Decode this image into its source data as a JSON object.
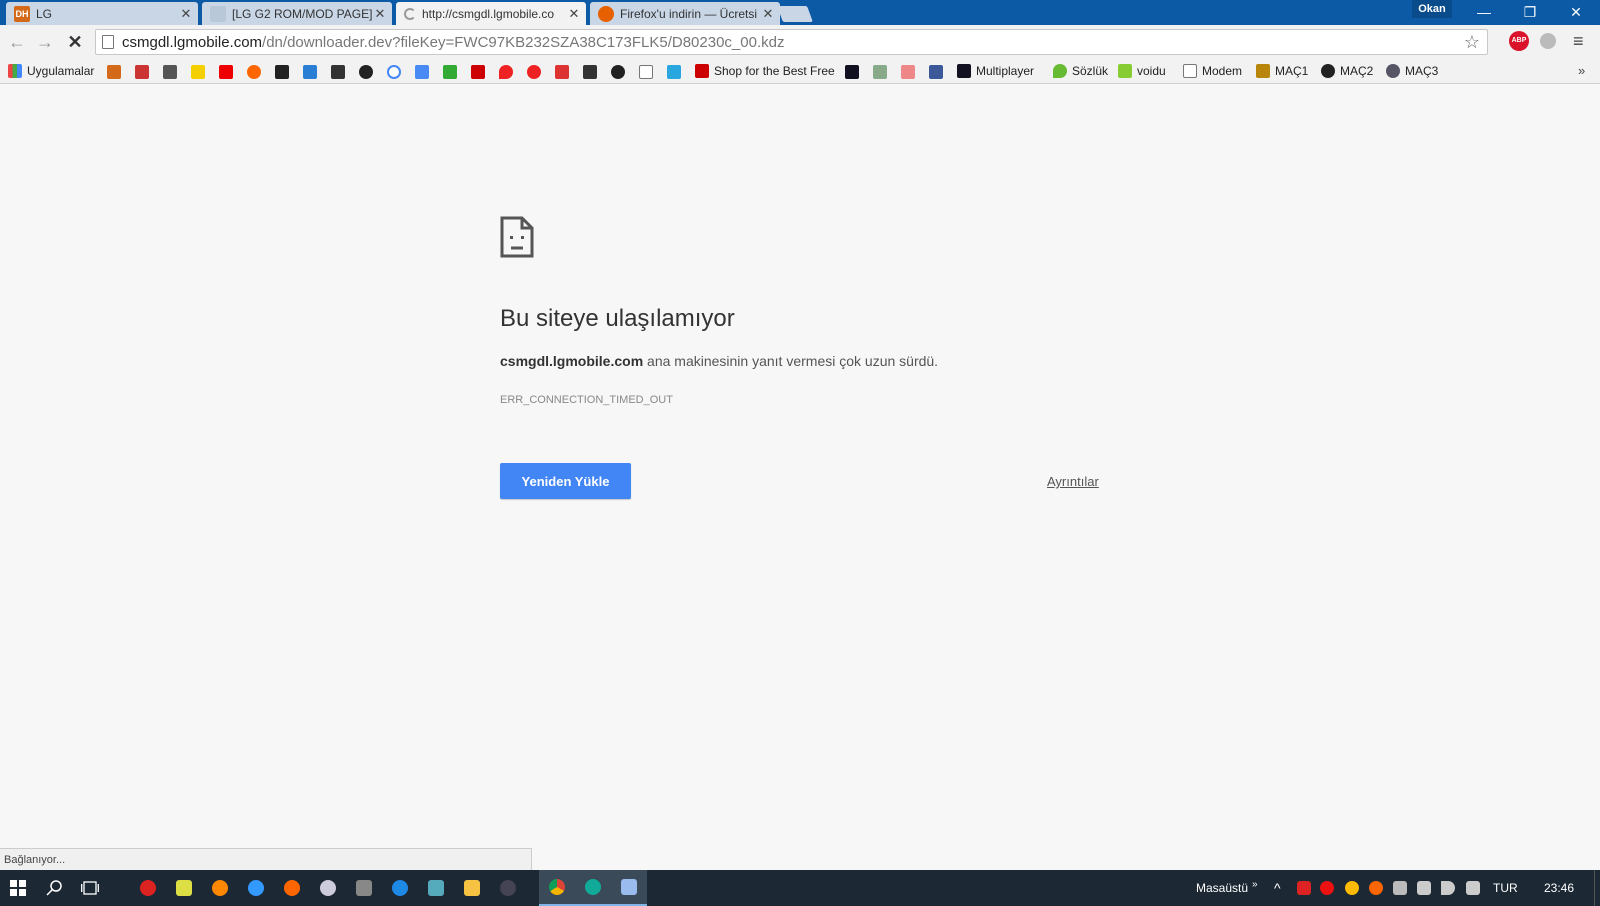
{
  "tabs": [
    {
      "title": "LG",
      "favicon_label": "DH",
      "favicon_color": "#d4691a"
    },
    {
      "title": "[LG G2 ROM/MOD PAGE][",
      "favicon_label": "",
      "favicon_color": "#9aa"
    },
    {
      "title": "http://csmgdl.lgmobile.co",
      "favicon_label": "",
      "favicon_color": "#bbb"
    },
    {
      "title": "Firefox'u indirin — Ücretsi",
      "favicon_label": "",
      "favicon_color": "#e66000"
    }
  ],
  "tab_close": "✕",
  "user_badge": "Okan",
  "window_controls": {
    "minimize": "—",
    "restore": "❐",
    "close": "✕"
  },
  "toolbar": {
    "back": "←",
    "forward": "→",
    "stop": "✕",
    "url_host": "csmgdl.lgmobile.com",
    "url_path": "/dn/downloader.dev?fileKey=FWC97KB232SZA38C173FLK5/D80230c_00.kdz",
    "star": "☆",
    "abp": "ABP",
    "menu": "≡"
  },
  "bookmarks": {
    "apps_label": "Uygulamalar",
    "shop_label": "Shop for the Best Free",
    "multiplayer_label": "Multiplayer",
    "sozluk_label": "Sözlük",
    "voidu_label": "voidu",
    "modem_label": "Modem",
    "mac1_label": "MAÇ1",
    "mac2_label": "MAÇ2",
    "mac3_label": "MAÇ3",
    "more": "»"
  },
  "error": {
    "title": "Bu siteye ulaşılamıyor",
    "host": "csmgdl.lgmobile.com",
    "desc_suffix": " ana makinesinin yanıt vermesi çok uzun sürdü.",
    "code": "ERR_CONNECTION_TIMED_OUT",
    "reload_label": "Yeniden Yükle",
    "details_label": "Ayrıntılar"
  },
  "status_text": "Bağlanıyor...",
  "taskbar": {
    "desktop_label": "Masaüstü",
    "desktop_more": "»",
    "chevron": "^",
    "language": "TUR",
    "clock": "23:46"
  }
}
